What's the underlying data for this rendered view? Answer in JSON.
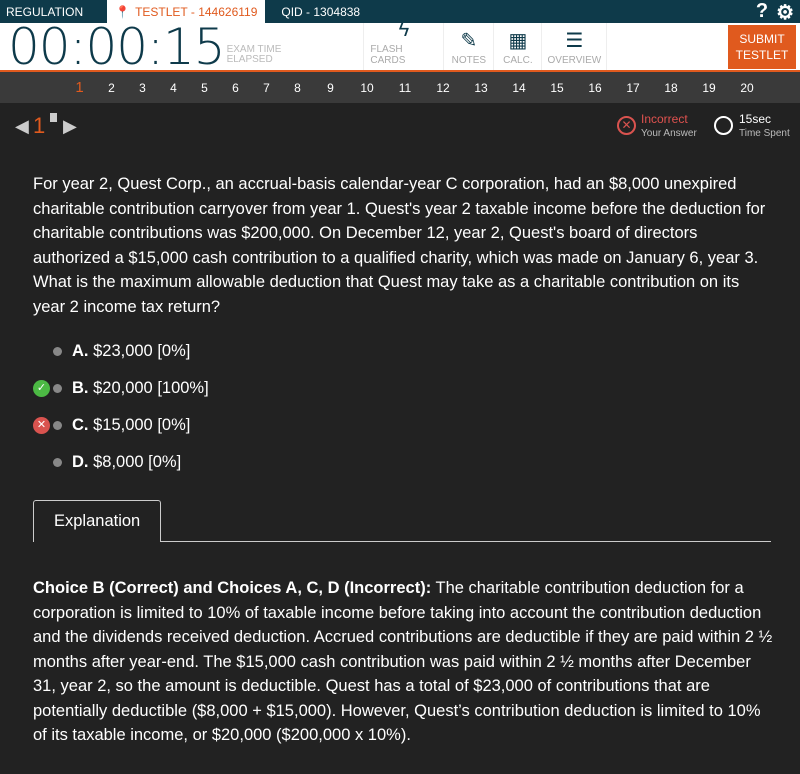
{
  "top": {
    "section": "REGULATION",
    "testlet": "TESTLET - 144626119",
    "qid": "QID - 1304838",
    "help": "?",
    "settings": "⚙"
  },
  "timer": {
    "value": "00:00:15",
    "label1": "EXAM TIME",
    "label2": "ELAPSED"
  },
  "tools": [
    {
      "label": "FLASH CARDS",
      "icon": "ϟ"
    },
    {
      "label": "NOTES",
      "icon": "✎"
    },
    {
      "label": "CALC.",
      "icon": "▦"
    },
    {
      "label": "OVERVIEW",
      "icon": "☰"
    }
  ],
  "submit": "SUBMIT TESTLET",
  "questions": [
    "1",
    "2",
    "3",
    "4",
    "5",
    "6",
    "7",
    "8",
    "9",
    "10",
    "11",
    "12",
    "13",
    "14",
    "15",
    "16",
    "17",
    "18",
    "19",
    "20"
  ],
  "current": "1",
  "result": {
    "status": "Incorrect",
    "status_sub": "Your Answer",
    "time": "15sec",
    "time_sub": "Time Spent"
  },
  "question": "For year 2, Quest Corp., an accrual-basis calendar-year C corporation, had an $8,000 unexpired charitable contribution carryover from year 1. Quest's year 2 taxable income before the deduction for charitable contributions was $200,000. On December 12, year 2, Quest's board of directors authorized a $15,000 cash contribution to a qualified charity, which was made on January 6, year 3. What is the maximum allowable deduction that Quest may take as a charitable contribution on its year 2 income tax return?",
  "answers": [
    {
      "letter": "A.",
      "text": "$23,000  [0%]"
    },
    {
      "letter": "B.",
      "text": "$20,000  [100%]"
    },
    {
      "letter": "C.",
      "text": "$15,000  [0%]"
    },
    {
      "letter": "D.",
      "text": "$8,000  [0%]"
    }
  ],
  "explanation_tab": "Explanation",
  "explanation_bold": "Choice B (Correct) and Choices A, C, D (Incorrect):",
  "explanation": " The charitable contribution deduction for a corporation is limited to 10% of taxable income before taking into account the contribution deduction and the dividends received deduction.  Accrued contributions are deductible if they are paid within 2 ½ months after year-end.  The $15,000 cash contribution was paid within 2 ½ months after December 31, year 2, so the amount is deductible.  Quest has a total of $23,000 of contributions that are potentially deductible ($8,000 + $15,000).  However, Quest’s contribution deduction is limited to 10% of its taxable income, or $20,000 ($200,000 x 10%)."
}
